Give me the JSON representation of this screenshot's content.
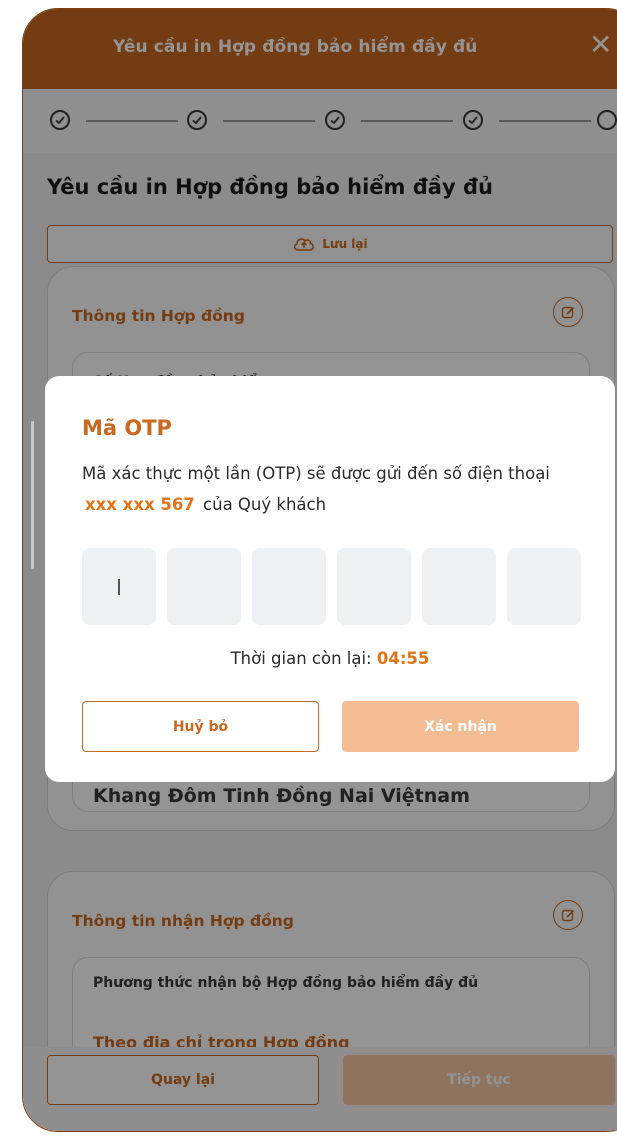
{
  "header": {
    "title": "Yêu cầu in Hợp đồng bảo hiểm đầy đủ",
    "close_symbol": "✕"
  },
  "stepper": {
    "steps": [
      {
        "state": "done"
      },
      {
        "state": "done"
      },
      {
        "state": "done"
      },
      {
        "state": "current"
      },
      {
        "state": "pending"
      }
    ]
  },
  "page": {
    "title": "Yêu cầu in Hợp đồng bảo hiểm đầy đủ",
    "save_label": "Lưu lại"
  },
  "contract_card": {
    "title": "Thông tin Hợp đồng",
    "field_label": "Số Hợp đồng bảo hiểm",
    "partial_value": "Khang Đôm Tinh Đồng Nai Việtnam"
  },
  "receive_card": {
    "title": "Thông tin nhận Hợp đồng",
    "field_label": "Phương thức nhận bộ Hợp đồng bảo hiểm đầy đủ",
    "field_value": "Theo địa chỉ trong Hợp đồng"
  },
  "bottom": {
    "back_label": "Quay lại",
    "next_label": "Tiếp tục"
  },
  "otp_modal": {
    "title": "Mã OTP",
    "message_part1": "Mã xác thực một lần (OTP) sẽ được gửi đến số điện thoại",
    "phone": "xxx xxx 567",
    "message_part2": "của Quý khách",
    "digits": [
      "",
      "",
      "",
      "",
      "",
      ""
    ],
    "timer_label": "Thời gian còn lại:",
    "timer_value": "04:55",
    "cancel_label": "Huỷ bỏ",
    "confirm_label": "Xác nhận"
  },
  "colors": {
    "brand": "#c9681f",
    "accent": "#e07316",
    "disabled_button": "#f4bc92"
  },
  "icons": [
    "close-icon",
    "check-icon",
    "cloud-upload-icon",
    "edit-icon"
  ]
}
